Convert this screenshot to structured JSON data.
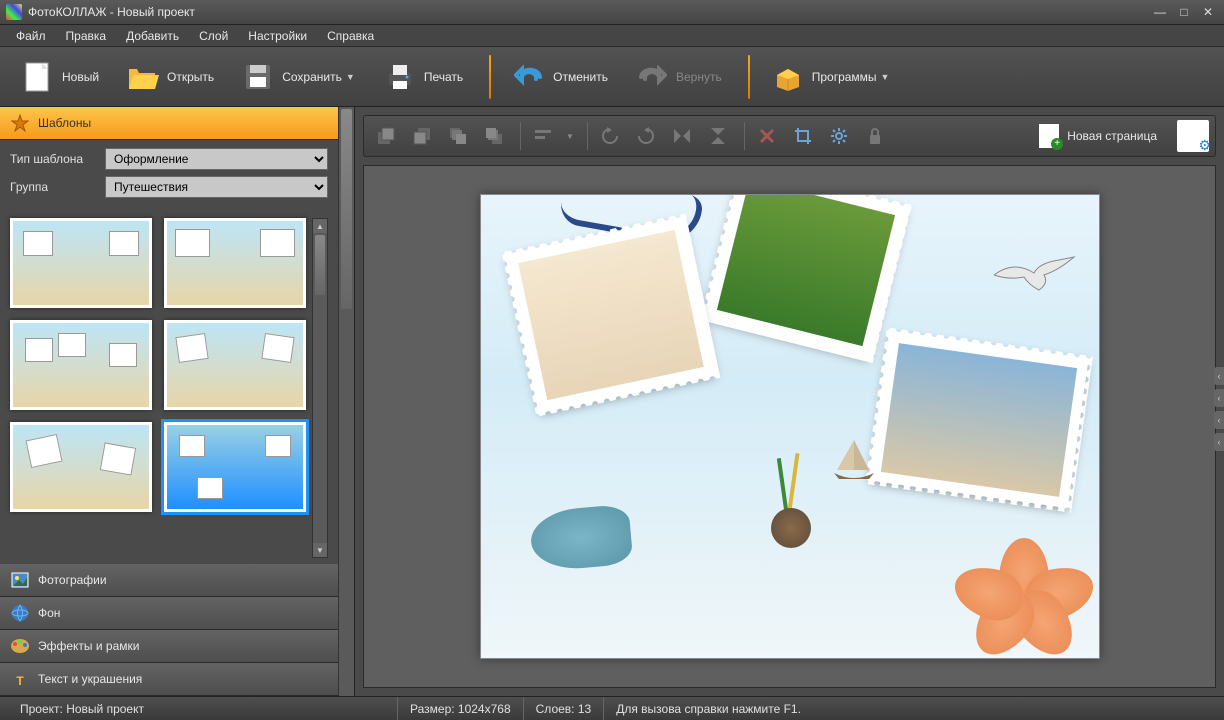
{
  "window": {
    "title": "ФотоКОЛЛАЖ - Новый проект"
  },
  "menu": {
    "file": "Файл",
    "edit": "Правка",
    "add": "Добавить",
    "layer": "Слой",
    "settings": "Настройки",
    "help": "Справка"
  },
  "toolbar": {
    "new": "Новый",
    "open": "Открыть",
    "save": "Сохранить",
    "print": "Печать",
    "undo": "Отменить",
    "redo": "Вернуть",
    "programs": "Программы"
  },
  "sidebar": {
    "templates": "Шаблоны",
    "template_type_label": "Тип шаблона",
    "template_type_value": "Оформление",
    "group_label": "Группа",
    "group_value": "Путешествия",
    "photos": "Фотографии",
    "background": "Фон",
    "effects": "Эффекты и рамки",
    "text": "Текст и украшения"
  },
  "canvas_toolbar": {
    "new_page": "Новая страница"
  },
  "statusbar": {
    "project": "Проект: Новый проект",
    "size": "Размер:  1024x768",
    "layers": "Слоев:  13",
    "hint": "Для вызова справки нажмите F1."
  }
}
